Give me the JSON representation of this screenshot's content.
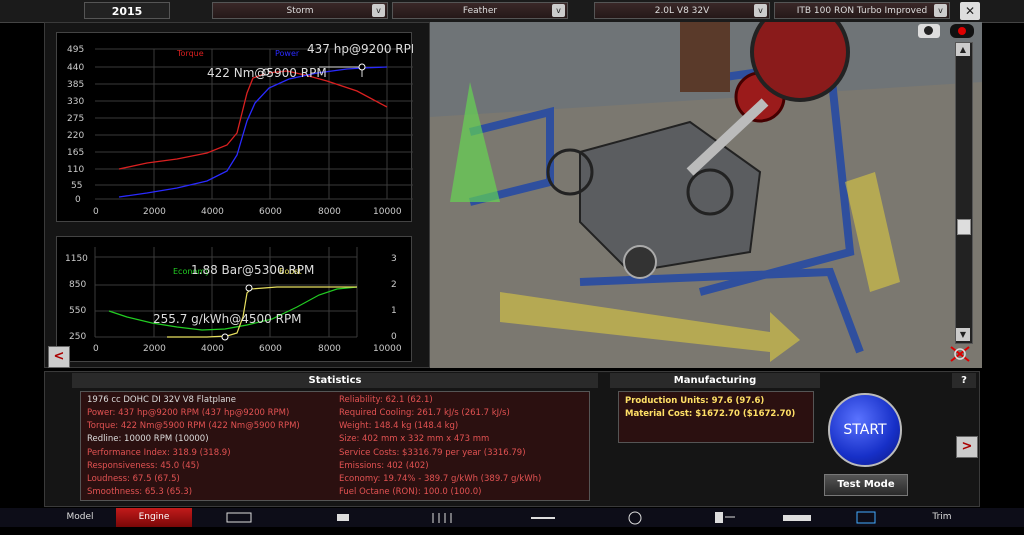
{
  "topbar": {
    "year": "2015",
    "family": "Storm",
    "variant": "Feather",
    "engine": "2.0L V8 32V",
    "fuel_system": "ITB 100 RON Turbo Improved",
    "dropdown_glyph": "v",
    "close_glyph": "✕"
  },
  "top_graph": {
    "y_ticks": [
      "495",
      "440",
      "385",
      "330",
      "275",
      "220",
      "165",
      "110",
      "55",
      "0"
    ],
    "x_ticks": [
      "0",
      "2000",
      "4000",
      "6000",
      "8000",
      "10000"
    ],
    "legend_torque": "Torque",
    "legend_power": "Power",
    "power_label": "437 hp@9200 RPM",
    "torque_label": "422 Nm@5900 RPM",
    "colors": {
      "torque": "#d92020",
      "power": "#2a2aff"
    }
  },
  "bottom_graph": {
    "left_ticks": [
      "1150",
      "850",
      "550",
      "250"
    ],
    "right_ticks": [
      "3",
      "2",
      "1",
      "0"
    ],
    "x_ticks": [
      "0",
      "2000",
      "4000",
      "6000",
      "8000",
      "10000"
    ],
    "legend_economy": "Economy",
    "legend_boost": "Boost",
    "boost_label": "1.88 Bar@5300 RPM",
    "economy_label": "255.7 g/kWh@4500 RPM",
    "colors": {
      "economy": "#22cc22",
      "boost": "#e8e060"
    }
  },
  "nav": {
    "prev": "<",
    "next": ">"
  },
  "stats": {
    "title": "Statistics",
    "help": "?",
    "left": [
      "1976 cc DOHC DI 32V V8 Flatplane",
      "Power: 437 hp@9200 RPM (437 hp@9200 RPM)",
      "Torque: 422 Nm@5900 RPM (422 Nm@5900 RPM)",
      "Redline: 10000 RPM (10000)",
      "Performance Index: 318.9 (318.9)",
      "Responsiveness: 45.0 (45)",
      "Loudness: 67.5 (67.5)",
      "Smoothness: 65.3 (65.3)"
    ],
    "right": [
      "Reliability: 62.1 (62.1)",
      "Required Cooling: 261.7 kJ/s (261.7 kJ/s)",
      "Weight: 148.4 kg (148.4 kg)",
      "Size: 402 mm x 332 mm x 473 mm",
      "Service Costs: $3316.79 per year (3316.79)",
      "Emissions: 402 (402)",
      "Economy: 19.74% - 389.7 g/kWh (389.7 g/kWh)",
      "Fuel Octane (RON): 100.0 (100.0)"
    ]
  },
  "manufacturing": {
    "title": "Manufacturing",
    "production_units": "Production Units: 97.6 (97.6)",
    "material_cost": "Material Cost: $1672.70 ($1672.70)"
  },
  "actions": {
    "start": "START",
    "test_mode": "Test Mode"
  },
  "bottom_tabs": {
    "model": "Model",
    "engine": "Engine",
    "trim": "Trim"
  },
  "icons": [
    "block-icon",
    "crank-icon",
    "heads-icon",
    "cam-icon",
    "turbo-icon",
    "fuel-icon",
    "exhaust-icon",
    "tuning-icon"
  ]
}
